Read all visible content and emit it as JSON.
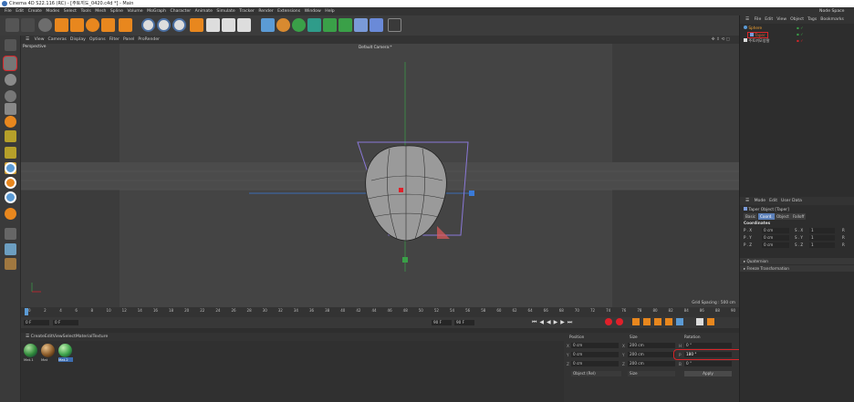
{
  "app": {
    "title": "Cinema 4D S22.116 (RC) - [주토끼도_0420.c4d *] - Main",
    "node_space": "Node Space"
  },
  "menu": [
    "File",
    "Edit",
    "Create",
    "Modes",
    "Select",
    "Tools",
    "Mesh",
    "Spline",
    "Volume",
    "MoGraph",
    "Character",
    "Animate",
    "Simulate",
    "Tracker",
    "Render",
    "Extensions",
    "Window",
    "Help"
  ],
  "viewport": {
    "menu": [
      "View",
      "Cameras",
      "Display",
      "Options",
      "Filter",
      "Panel",
      "ProRender"
    ],
    "label": "Perspective",
    "camera": "Default Camera:*",
    "grid_spacing": "Grid Spacing : 500 cm"
  },
  "objects": {
    "menu": [
      "File",
      "Edit",
      "View",
      "Object",
      "Tags",
      "Bookmarks"
    ],
    "items": [
      {
        "name": "Sphere",
        "color": "#f0a030"
      },
      {
        "name": "Taper",
        "color": "#e05a30"
      },
      {
        "name": "주토끼모양팔",
        "color": "#c8c8c8"
      }
    ]
  },
  "attributes": {
    "menu": [
      "Mode",
      "Edit",
      "User Data"
    ],
    "object_title": "Taper Object [Taper]",
    "tabs": [
      "Basic",
      "Coord.",
      "Object",
      "Falloff"
    ],
    "active_tab": "Coord.",
    "section": "Coordinates",
    "rows": [
      {
        "p": "P . X",
        "pv": "0 cm",
        "s": "S . X",
        "sv": "1",
        "r": "R"
      },
      {
        "p": "P . Y",
        "pv": "0 cm",
        "s": "S . Y",
        "sv": "1",
        "r": "R"
      },
      {
        "p": "P . Z",
        "pv": "0 cm",
        "s": "S . Z",
        "sv": "1",
        "r": "R"
      }
    ],
    "collapsed": [
      "Quaternion",
      "Freeze Transformation"
    ]
  },
  "timeline": {
    "ticks": [
      "0",
      "2",
      "4",
      "6",
      "8",
      "10",
      "12",
      "14",
      "16",
      "18",
      "20",
      "22",
      "24",
      "26",
      "28",
      "30",
      "32",
      "34",
      "36",
      "38",
      "40",
      "42",
      "44",
      "46",
      "48",
      "50",
      "52",
      "54",
      "56",
      "58",
      "60",
      "62",
      "64",
      "66",
      "68",
      "70",
      "72",
      "74",
      "76",
      "78",
      "80",
      "82",
      "84",
      "86",
      "88",
      "90"
    ],
    "current_frame": "0 F",
    "start": "0 F",
    "start2": "0 F",
    "end": "90 F",
    "end2": "90 F",
    "frame_readout": "0 F"
  },
  "materials": {
    "menu": [
      "Create",
      "Edit",
      "View",
      "Select",
      "Material",
      "Texture"
    ],
    "items": [
      {
        "name": "Mat.1",
        "color": "#2f8a3a"
      },
      {
        "name": "Mat",
        "color": "#8a5a28"
      },
      {
        "name": "Mat.2",
        "color": "#3aa048"
      }
    ]
  },
  "coordinates": {
    "headers": [
      "Position",
      "Size",
      "Rotation"
    ],
    "rows": [
      {
        "axis": "X",
        "pos": "0 cm",
        "saxis": "X",
        "size": "200 cm",
        "raxis": "H",
        "rot": "0 °"
      },
      {
        "axis": "Y",
        "pos": "0 cm",
        "saxis": "Y",
        "size": "200 cm",
        "raxis": "P",
        "rot": "180 °"
      },
      {
        "axis": "Z",
        "pos": "0 cm",
        "saxis": "Z",
        "size": "200 cm",
        "raxis": "B",
        "rot": "0 °"
      }
    ],
    "mode_select": "Object (Rel)",
    "size_select": "Size",
    "apply": "Apply"
  }
}
